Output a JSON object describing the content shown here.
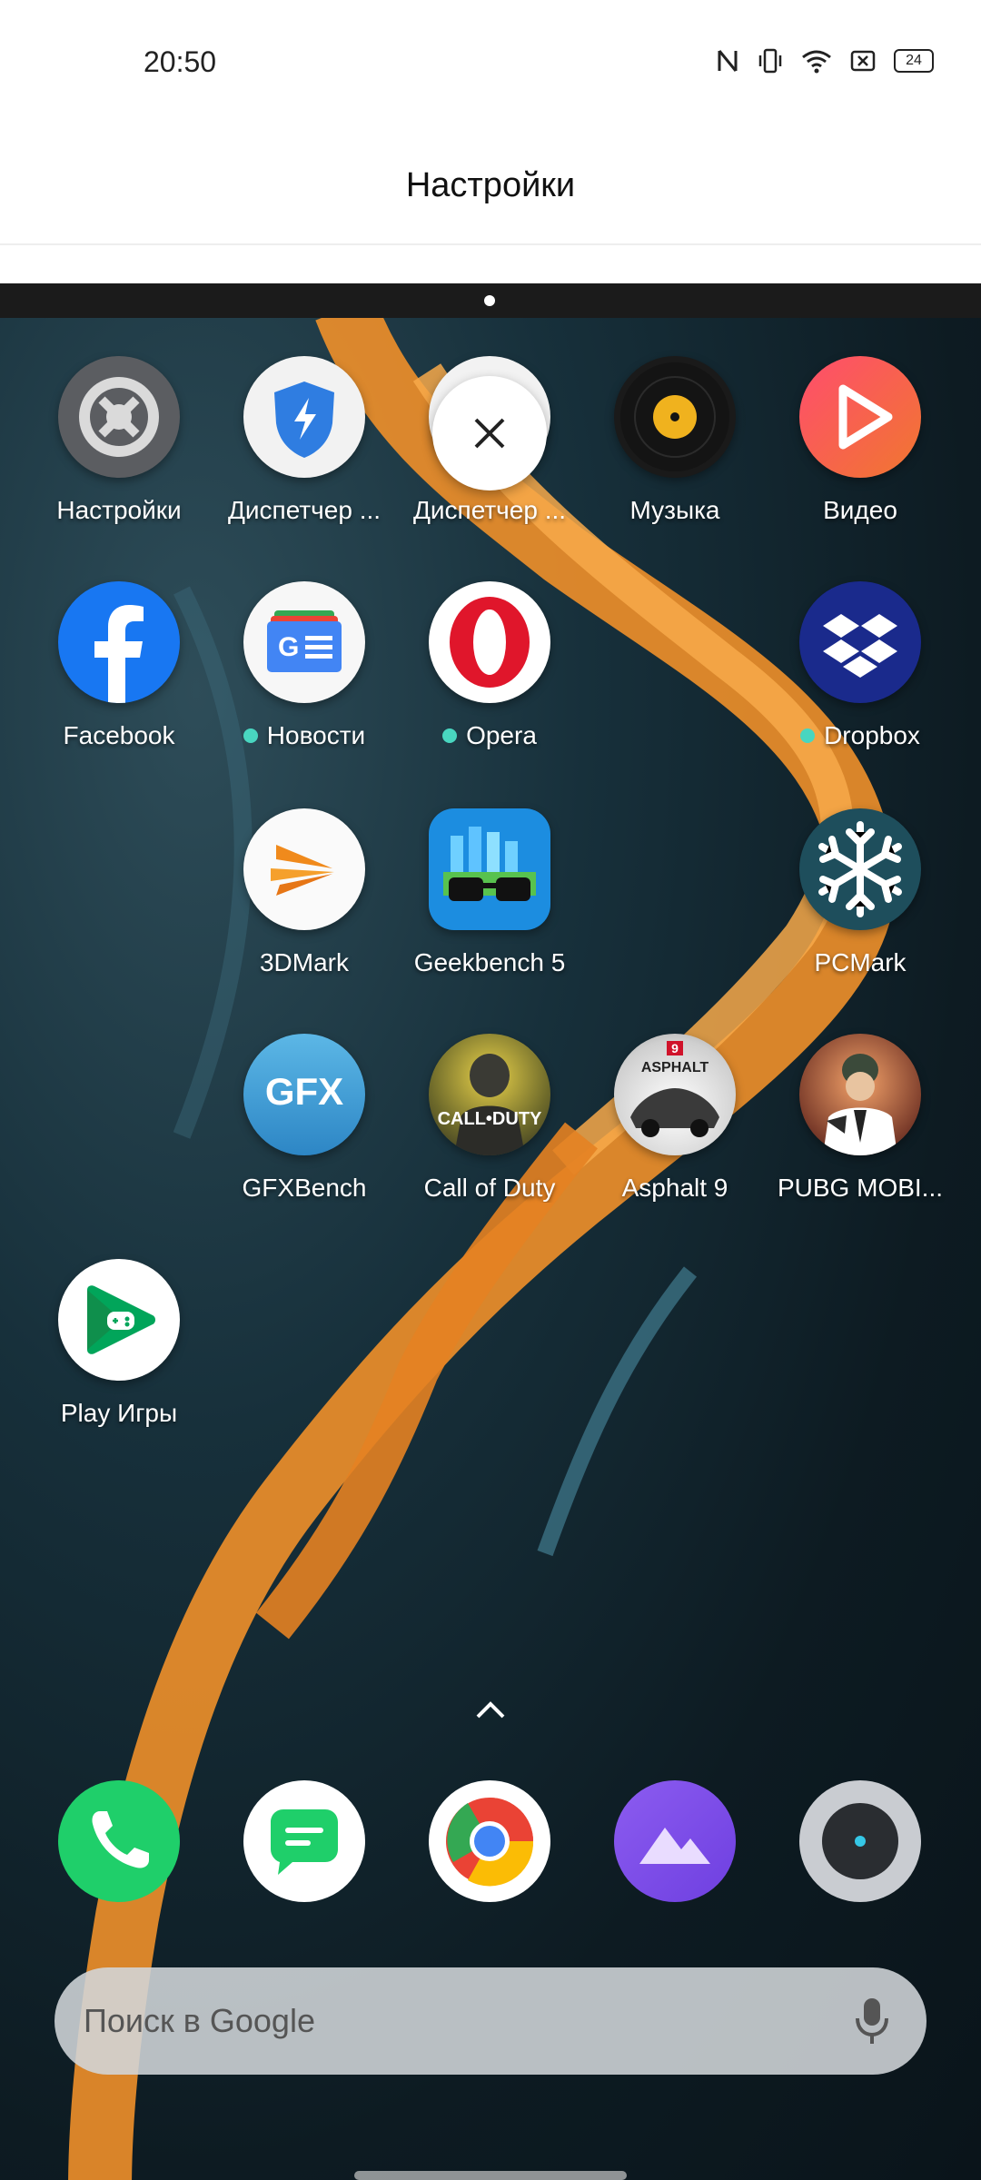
{
  "status_bar": {
    "time": "20:50",
    "battery_level": "24"
  },
  "header": {
    "title": "Настройки"
  },
  "apps": [
    {
      "label": "Настройки",
      "icon": "settings-gear-icon",
      "dot": false
    },
    {
      "label": "Диспетчер ...",
      "icon": "shield-bolt-icon",
      "dot": false
    },
    {
      "label": "Диспетчер ...",
      "icon": "close-x-icon",
      "dot": false
    },
    {
      "label": "Музыка",
      "icon": "vinyl-record-icon",
      "dot": false
    },
    {
      "label": "Видео",
      "icon": "play-triangle-icon",
      "dot": false
    },
    {
      "label": "Facebook",
      "icon": "facebook-f-icon",
      "dot": false
    },
    {
      "label": "Новости",
      "icon": "google-news-icon",
      "dot": true
    },
    {
      "label": "Opera",
      "icon": "opera-o-icon",
      "dot": true
    },
    {
      "label": "Dropbox",
      "icon": "dropbox-box-icon",
      "dot": true
    },
    {
      "label": "3DMark",
      "icon": "3dmark-wings-icon",
      "dot": false
    },
    {
      "label": "Geekbench 5",
      "icon": "geekbench-glasses-icon",
      "dot": false
    },
    {
      "label": "PCMark",
      "icon": "snowflake-icon",
      "dot": false
    },
    {
      "label": "GFXBench",
      "icon": "gfx-text-icon",
      "dot": false
    },
    {
      "label": "Call of Duty",
      "icon": "call-of-duty-soldier-icon",
      "dot": false
    },
    {
      "label": "Asphalt 9",
      "icon": "asphalt-car-icon",
      "dot": false
    },
    {
      "label": "PUBG MOBI...",
      "icon": "pubg-soldier-icon",
      "dot": false
    },
    {
      "label": "Play Игры",
      "icon": "play-games-controller-icon",
      "dot": false
    }
  ],
  "dock": [
    {
      "name": "phone",
      "icon": "phone-handset-icon"
    },
    {
      "name": "messages",
      "icon": "chat-bubble-icon"
    },
    {
      "name": "chrome",
      "icon": "chrome-icon"
    },
    {
      "name": "gallery",
      "icon": "mountains-icon"
    },
    {
      "name": "camera",
      "icon": "camera-lens-icon"
    }
  ],
  "search": {
    "placeholder": "Поиск в Google"
  },
  "colors": {
    "accent_dot": "#49d6c0",
    "river_orange": "#f0902a"
  }
}
